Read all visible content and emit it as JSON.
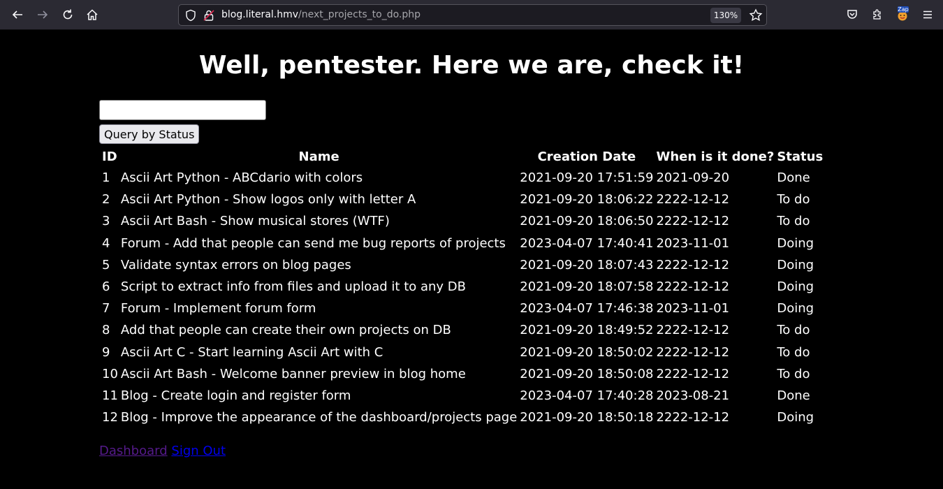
{
  "browser": {
    "url_host": "blog.literal.hmv",
    "url_path": "/next_projects_to_do.php",
    "zoom": "130%",
    "extension_badge": "Zap",
    "icons": [
      "back-icon",
      "forward-icon",
      "reload-icon",
      "home-icon",
      "shield-icon",
      "lock-icon",
      "star-icon",
      "pocket-icon",
      "extensions-icon",
      "menu-icon"
    ]
  },
  "page": {
    "title": "Well, pentester. Here we are, check it!",
    "search": {
      "value": "",
      "placeholder": ""
    },
    "query_button": "Query by Status",
    "table": {
      "headers": [
        "ID",
        "Name",
        "Creation Date",
        "When is it done?",
        "Status"
      ],
      "rows": [
        [
          "1",
          "Ascii Art Python - ABCdario with colors",
          "2021-09-20 17:51:59",
          "2021-09-20",
          "Done"
        ],
        [
          "2",
          "Ascii Art Python - Show logos only with letter A",
          "2021-09-20 18:06:22",
          "2222-12-12",
          "To do"
        ],
        [
          "3",
          "Ascii Art Bash - Show musical stores (WTF)",
          "2021-09-20 18:06:50",
          "2222-12-12",
          "To do"
        ],
        [
          "4",
          "Forum - Add that people can send me bug reports of projects",
          "2023-04-07 17:40:41",
          "2023-11-01",
          "Doing"
        ],
        [
          "5",
          "Validate syntax errors on blog pages",
          "2021-09-20 18:07:43",
          "2222-12-12",
          "Doing"
        ],
        [
          "6",
          "Script to extract info from files and upload it to any DB",
          "2021-09-20 18:07:58",
          "2222-12-12",
          "Doing"
        ],
        [
          "7",
          "Forum - Implement forum form",
          "2023-04-07 17:46:38",
          "2023-11-01",
          "Doing"
        ],
        [
          "8",
          "Add that people can create their own projects on DB",
          "2021-09-20 18:49:52",
          "2222-12-12",
          "To do"
        ],
        [
          "9",
          "Ascii Art C - Start learning Ascii Art with C",
          "2021-09-20 18:50:02",
          "2222-12-12",
          "To do"
        ],
        [
          "10",
          "Ascii Art Bash - Welcome banner preview in blog home",
          "2021-09-20 18:50:08",
          "2222-12-12",
          "To do"
        ],
        [
          "11",
          "Blog - Create login and register form",
          "2023-04-07 17:40:28",
          "2023-08-21",
          "Done"
        ],
        [
          "12",
          "Blog - Improve the appearance of the dashboard/projects page",
          "2021-09-20 18:50:18",
          "2222-12-12",
          "Doing"
        ]
      ]
    },
    "links": {
      "dashboard": "Dashboard",
      "sign_out": "Sign Out"
    }
  }
}
